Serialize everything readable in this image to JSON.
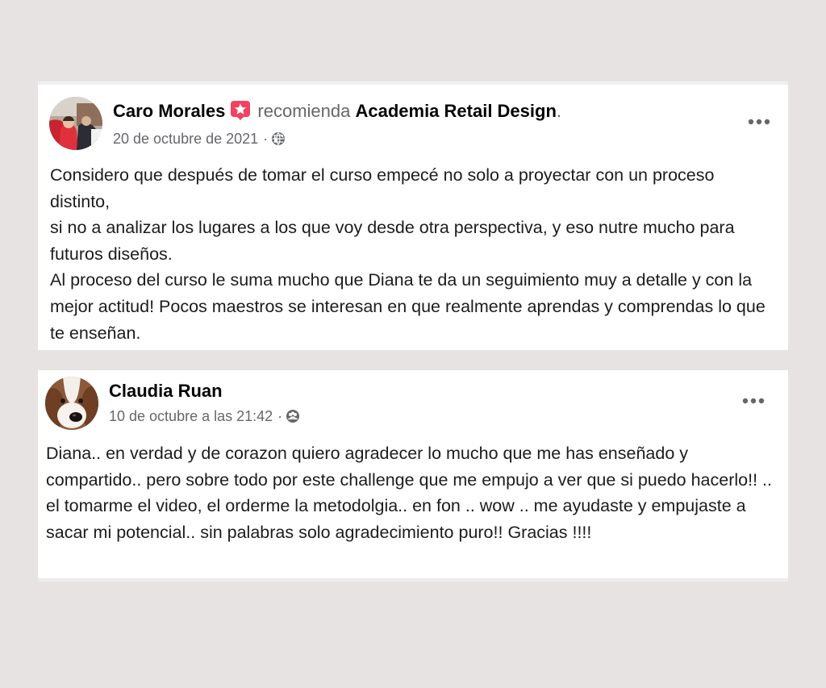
{
  "posts": [
    {
      "author": "Caro Morales",
      "recommend_icon": "recommend-star-icon",
      "recommend_verb": "recomienda",
      "page_name": "Academia Retail Design",
      "period": ".",
      "date": "20 de octubre de 2021",
      "separator": "·",
      "audience_icon": "globe-icon",
      "more_icon": "more-options-icon",
      "paragraphs": [
        "Considero que después de tomar el curso empecé no solo a proyectar con un proceso distinto,",
        "si no a analizar los lugares a los que voy desde otra perspectiva, y eso nutre mucho para futuros diseños.",
        "Al proceso del curso le suma mucho que Diana te da un seguimiento muy a detalle y con la mejor actitud! Pocos maestros se interesan en que realmente aprendas y comprendas lo que te enseñan."
      ]
    },
    {
      "author": "Claudia Ruan",
      "date": "10 de octubre a las 21:42",
      "separator": "·",
      "audience_icon": "friends-icon",
      "more_icon": "more-options-icon",
      "paragraphs": [
        "Diana.. en verdad y de corazon quiero agradecer lo mucho que me has enseñado y compartido.. pero sobre todo por este challenge que me empujo a ver que si puedo hacerlo!! .. el tomarme el video, el orderme la metodolgia.. en fon .. wow .. me ayudaste y empujaste a sacar mi potencial.. sin palabras solo agradecimiento puro!! Gracias !!!!"
      ]
    }
  ],
  "colors": {
    "background": "#e7e3e2",
    "card": "#ffffff",
    "primary_text": "#050505",
    "secondary_text": "#65676b",
    "recommend_badge": "#f3425f"
  }
}
